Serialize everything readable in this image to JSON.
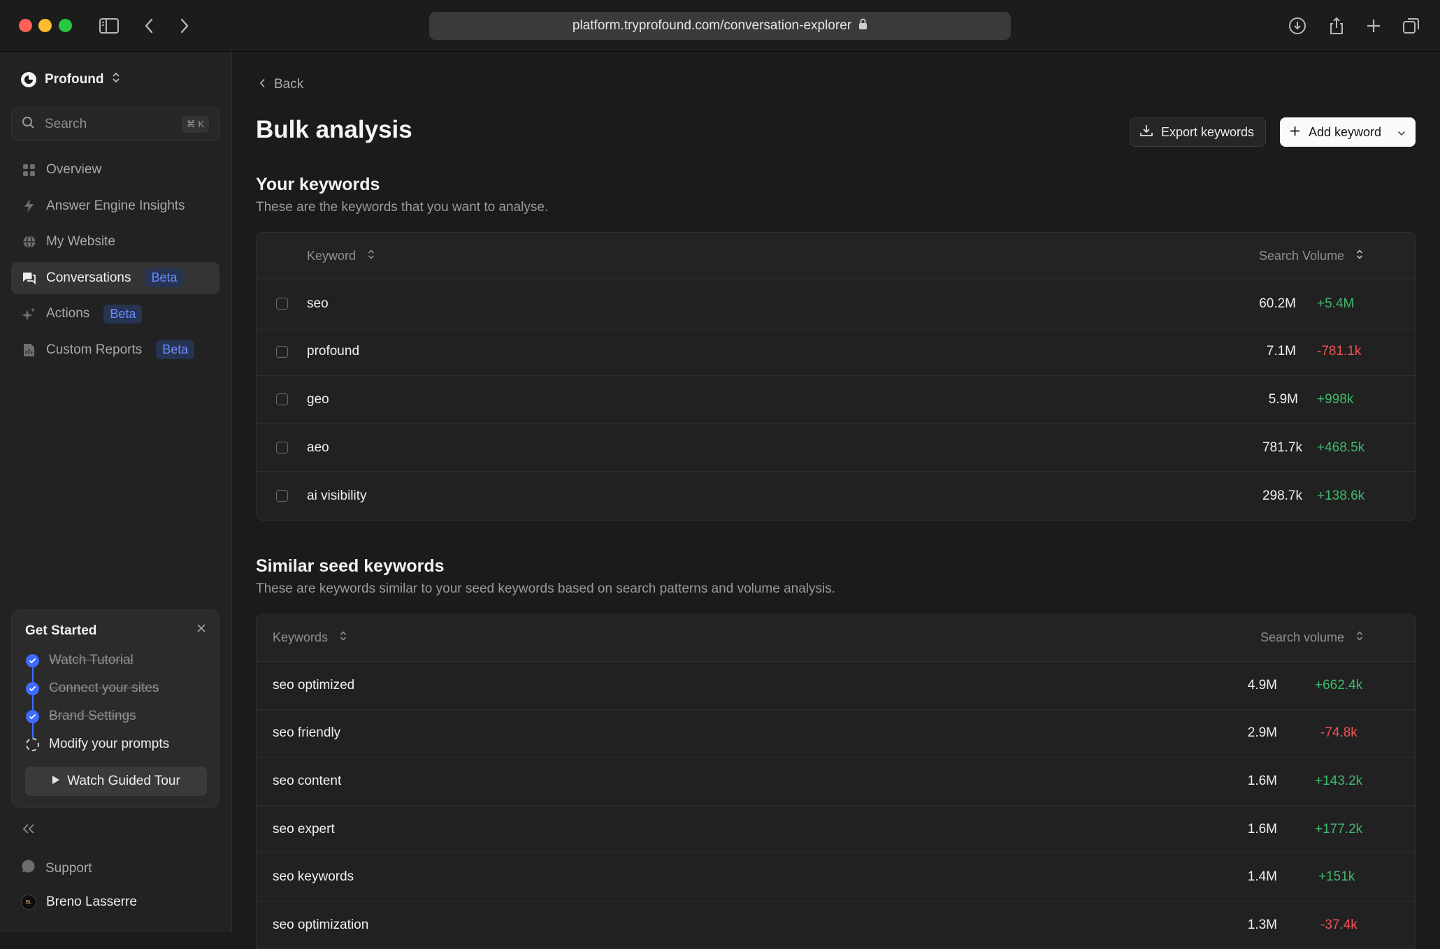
{
  "browser": {
    "url": "platform.tryprofound.com/conversation-explorer"
  },
  "sidebar": {
    "org_name": "Profound",
    "search_placeholder": "Search",
    "search_shortcut": "⌘ K",
    "nav": [
      {
        "label": "Overview",
        "icon": "grid-icon",
        "active": false,
        "badge": ""
      },
      {
        "label": "Answer Engine Insights",
        "icon": "bolt-icon",
        "active": false,
        "badge": ""
      },
      {
        "label": "My Website",
        "icon": "globe-icon",
        "active": false,
        "badge": ""
      },
      {
        "label": "Conversations",
        "icon": "chat-icon",
        "active": true,
        "badge": "Beta"
      },
      {
        "label": "Actions",
        "icon": "sparkle-icon",
        "active": false,
        "badge": "Beta"
      },
      {
        "label": "Custom Reports",
        "icon": "report-icon",
        "active": false,
        "badge": "Beta"
      }
    ],
    "get_started": {
      "title": "Get Started",
      "steps": [
        {
          "label": "Watch Tutorial",
          "done": true
        },
        {
          "label": "Connect your sites",
          "done": true
        },
        {
          "label": "Brand Settings",
          "done": true
        },
        {
          "label": "Modify your prompts",
          "done": false
        }
      ],
      "tour_label": "Watch Guided Tour"
    },
    "support_label": "Support",
    "user_name": "Breno Lasserre",
    "user_initials": "BL"
  },
  "main": {
    "back_label": "Back",
    "title": "Bulk analysis",
    "export_label": "Export keywords",
    "add_label": "Add keyword",
    "your_keywords": {
      "title": "Your keywords",
      "subtitle": "These are the keywords that you want to analyse.",
      "col_keyword": "Keyword",
      "col_volume": "Search Volume",
      "rows": [
        {
          "keyword": "seo",
          "volume": "60.2M",
          "delta": "+5.4M",
          "trend": "pos"
        },
        {
          "keyword": "profound",
          "volume": "7.1M",
          "delta": "-781.1k",
          "trend": "neg"
        },
        {
          "keyword": "geo",
          "volume": "5.9M",
          "delta": "+998k",
          "trend": "pos"
        },
        {
          "keyword": "aeo",
          "volume": "781.7k",
          "delta": "+468.5k",
          "trend": "pos"
        },
        {
          "keyword": "ai visibility",
          "volume": "298.7k",
          "delta": "+138.6k",
          "trend": "pos"
        }
      ]
    },
    "similar_keywords": {
      "title": "Similar seed keywords",
      "subtitle": "These are keywords similar to your seed keywords based on search patterns and volume analysis.",
      "col_keyword": "Keywords",
      "col_volume": "Search volume",
      "rows": [
        {
          "keyword": "seo optimized",
          "volume": "4.9M",
          "delta": "+662.4k",
          "trend": "pos"
        },
        {
          "keyword": "seo friendly",
          "volume": "2.9M",
          "delta": "-74.8k",
          "trend": "neg"
        },
        {
          "keyword": "seo content",
          "volume": "1.6M",
          "delta": "+143.2k",
          "trend": "pos"
        },
        {
          "keyword": "seo expert",
          "volume": "1.6M",
          "delta": "+177.2k",
          "trend": "pos"
        },
        {
          "keyword": "seo keywords",
          "volume": "1.4M",
          "delta": "+151k",
          "trend": "pos"
        },
        {
          "keyword": "seo optimization",
          "volume": "1.3M",
          "delta": "-37.4k",
          "trend": "neg"
        }
      ]
    }
  }
}
